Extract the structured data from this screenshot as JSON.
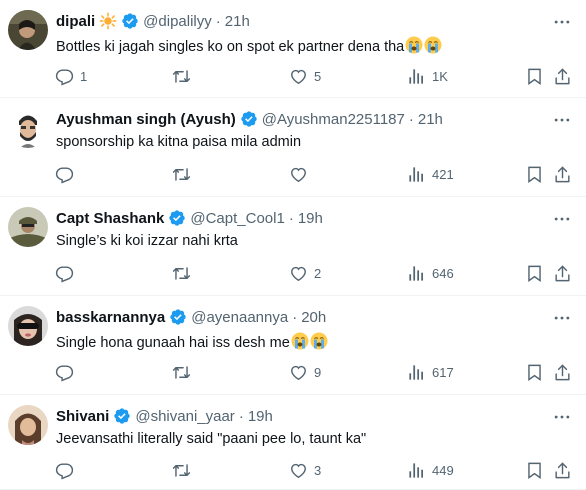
{
  "colors": {
    "verified": "#1d9bf0",
    "text": "#0f1419",
    "muted": "#536471",
    "divider": "#eff3f4",
    "emoji_face": "#ffcc4d",
    "emoji_tear": "#5dadec",
    "sun_badge": "#ffac33"
  },
  "tweets": [
    {
      "name": "dipali",
      "badges": [
        "sun-badge-icon",
        "verified-icon"
      ],
      "handle": "@dipalilyy",
      "dot": "·",
      "time": "21h",
      "text": "Bottles ki jagah singles ko on spot ek partner dena tha",
      "emojis": [
        "loudly-crying-face-icon",
        "loudly-crying-face-icon"
      ],
      "replies": "1",
      "retweets": "",
      "likes": "5",
      "views": "1K"
    },
    {
      "name": "Ayushman singh (Ayush)",
      "badges": [
        "verified-icon"
      ],
      "handle": "@Ayushman2251187",
      "dot": "·",
      "time": "21h",
      "text": "sponsorship ka kitna paisa mila admin",
      "emojis": [],
      "replies": "",
      "retweets": "",
      "likes": "",
      "views": "421"
    },
    {
      "name": "Capt Shashank",
      "badges": [
        "verified-icon"
      ],
      "handle": "@Capt_Cool1",
      "dot": "·",
      "time": "19h",
      "text": "Single’s ki koi izzar nahi krta",
      "emojis": [],
      "replies": "",
      "retweets": "",
      "likes": "2",
      "views": "646"
    },
    {
      "name": "basskarnannya",
      "badges": [
        "verified-icon"
      ],
      "handle": "@ayenaannya",
      "dot": "·",
      "time": "20h",
      "text": "Single hona gunaah hai iss desh me",
      "emojis": [
        "loudly-crying-face-icon",
        "loudly-crying-face-icon"
      ],
      "replies": "",
      "retweets": "",
      "likes": "9",
      "views": "617"
    },
    {
      "name": "Shivani",
      "badges": [
        "verified-icon"
      ],
      "handle": "@shivani_yaar",
      "dot": "·",
      "time": "19h",
      "text": "Jeevansathi literally said \"paani pee lo, taunt ka\"",
      "emojis": [],
      "replies": "",
      "retweets": "",
      "likes": "3",
      "views": "449"
    }
  ]
}
